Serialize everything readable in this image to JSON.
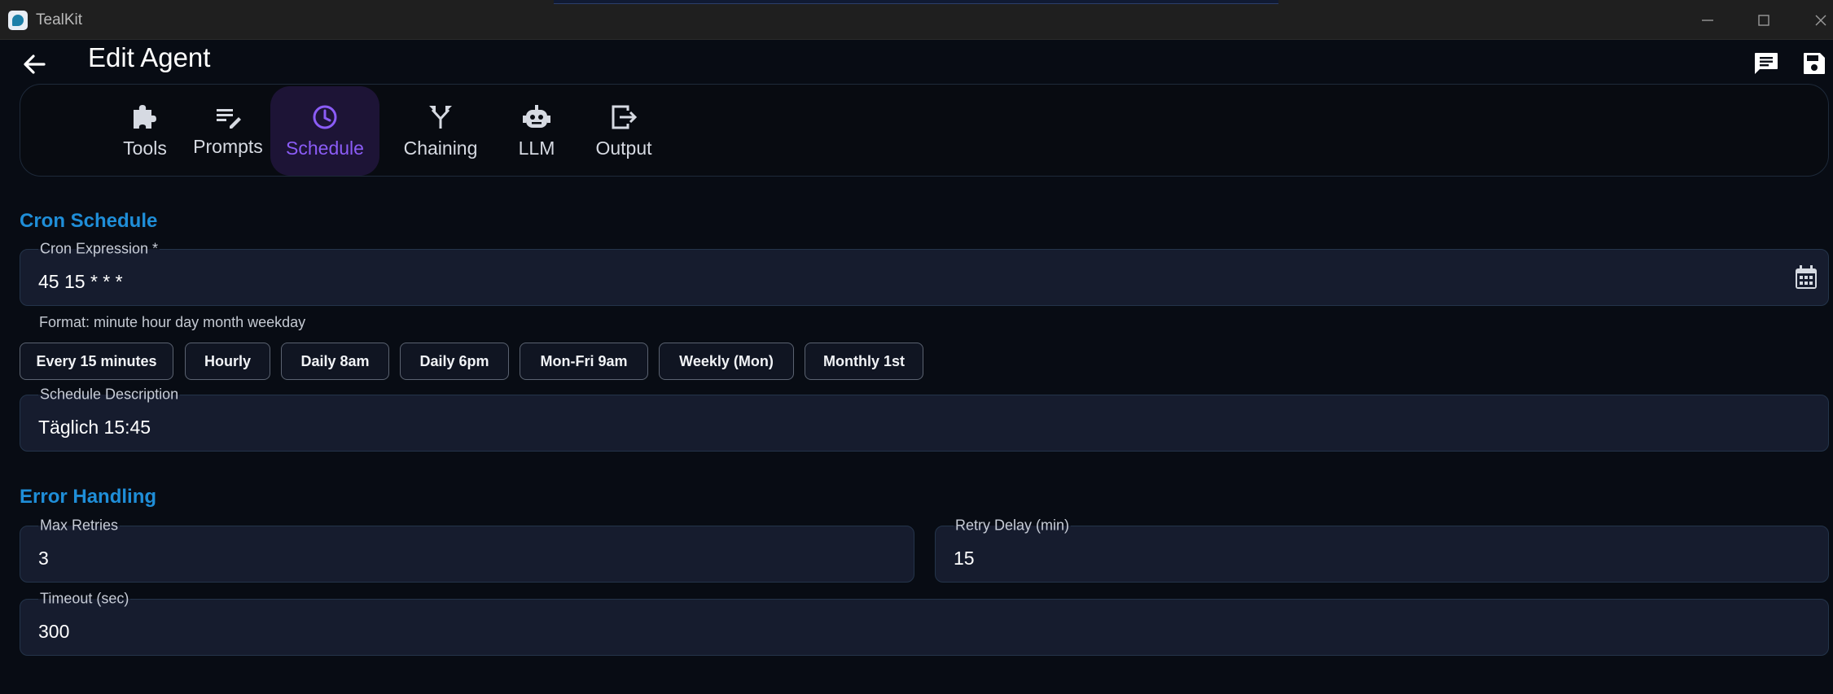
{
  "window": {
    "app_title": "TealKit"
  },
  "header": {
    "title": "Edit Agent"
  },
  "tabs": [
    {
      "label": "Tools",
      "icon": "puzzle-icon"
    },
    {
      "label": "Prompts",
      "icon": "edit-note-icon"
    },
    {
      "label": "Schedule",
      "icon": "clock-icon",
      "active": true
    },
    {
      "label": "Chaining",
      "icon": "merge-icon"
    },
    {
      "label": "LLM",
      "icon": "robot-icon"
    },
    {
      "label": "Output",
      "icon": "exit-icon"
    }
  ],
  "cron": {
    "section_title": "Cron Schedule",
    "expression_label": "Cron Expression *",
    "expression_value": "45 15 * * *",
    "helper": "Format: minute hour day month weekday",
    "presets": [
      "Every 15 minutes",
      "Hourly",
      "Daily 8am",
      "Daily 6pm",
      "Mon-Fri 9am",
      "Weekly (Mon)",
      "Monthly 1st"
    ],
    "description_label": "Schedule Description",
    "description_value": "Täglich 15:45"
  },
  "error_handling": {
    "section_title": "Error Handling",
    "max_retries_label": "Max Retries",
    "max_retries_value": "3",
    "retry_delay_label": "Retry Delay (min)",
    "retry_delay_value": "15",
    "timeout_label": "Timeout (sec)",
    "timeout_value": "300"
  },
  "colors": {
    "accent": "#8b5cf6",
    "section_title": "#1f8ed8",
    "background": "#080c14",
    "field_bg": "#161c2e"
  }
}
